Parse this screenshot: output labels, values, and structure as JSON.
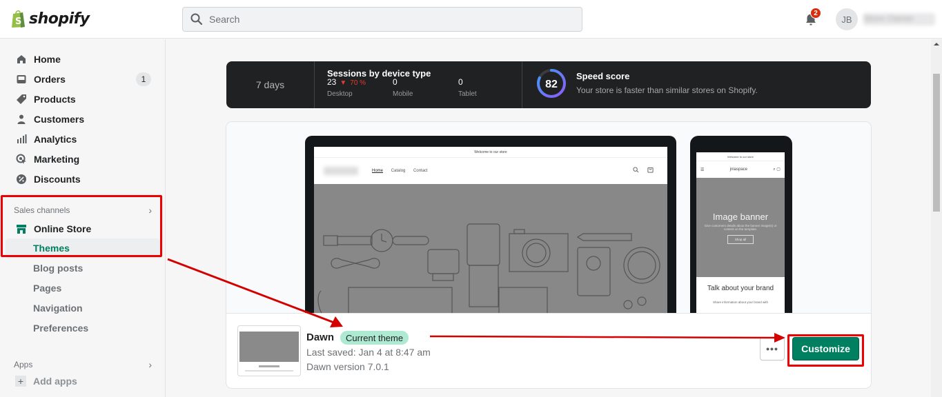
{
  "app": {
    "brand": "shopify"
  },
  "header": {
    "search_placeholder": "Search",
    "notifications_count": "2",
    "avatar_initials": "JB",
    "store_name": "Store Owner"
  },
  "sidebar": {
    "items": [
      {
        "label": "Home",
        "icon": "home-icon"
      },
      {
        "label": "Orders",
        "icon": "orders-icon",
        "badge": "1"
      },
      {
        "label": "Products",
        "icon": "tag-icon"
      },
      {
        "label": "Customers",
        "icon": "person-icon"
      },
      {
        "label": "Analytics",
        "icon": "bar-chart-icon"
      },
      {
        "label": "Marketing",
        "icon": "target-icon"
      },
      {
        "label": "Discounts",
        "icon": "discount-icon"
      }
    ],
    "sales_channels_label": "Sales channels",
    "online_store_label": "Online Store",
    "online_store_subitems": [
      {
        "label": "Themes",
        "active": true
      },
      {
        "label": "Blog posts"
      },
      {
        "label": "Pages"
      },
      {
        "label": "Navigation"
      },
      {
        "label": "Preferences"
      }
    ],
    "apps_label": "Apps",
    "add_apps_label": "Add apps"
  },
  "stats": {
    "period": "7 days",
    "sessions_title": "Sessions by device type",
    "devices": [
      {
        "label": "Desktop",
        "value": "23",
        "trend": "70 %",
        "trend_direction": "down"
      },
      {
        "label": "Mobile",
        "value": "0"
      },
      {
        "label": "Tablet",
        "value": "0"
      }
    ],
    "speed_score": "82",
    "speed_score_value": 82,
    "speed_title": "Speed score",
    "speed_desc": "Your store is faster than similar stores on Shopify."
  },
  "preview": {
    "announcement": "Welcome to our store",
    "nav": [
      "Home",
      "Catalog",
      "Contact"
    ],
    "mobile_store_name": "jniaspace",
    "banner_title": "Image banner",
    "banner_desc": "Give customers details about the banner image(s) or content on the template.",
    "banner_button": "Shop all",
    "brand_heading": "Talk about your brand",
    "brand_text": "Share information about your brand with"
  },
  "theme": {
    "name": "Dawn",
    "badge": "Current theme",
    "last_saved": "Last saved: Jan 4 at 8:47 am",
    "version": "Dawn version 7.0.1",
    "more_label": "•••",
    "customize_label": "Customize"
  },
  "colors": {
    "accent_green": "#008060",
    "badge_green": "#aee9d1",
    "annotation_red": "#ee0000",
    "stats_bg": "#202123"
  }
}
